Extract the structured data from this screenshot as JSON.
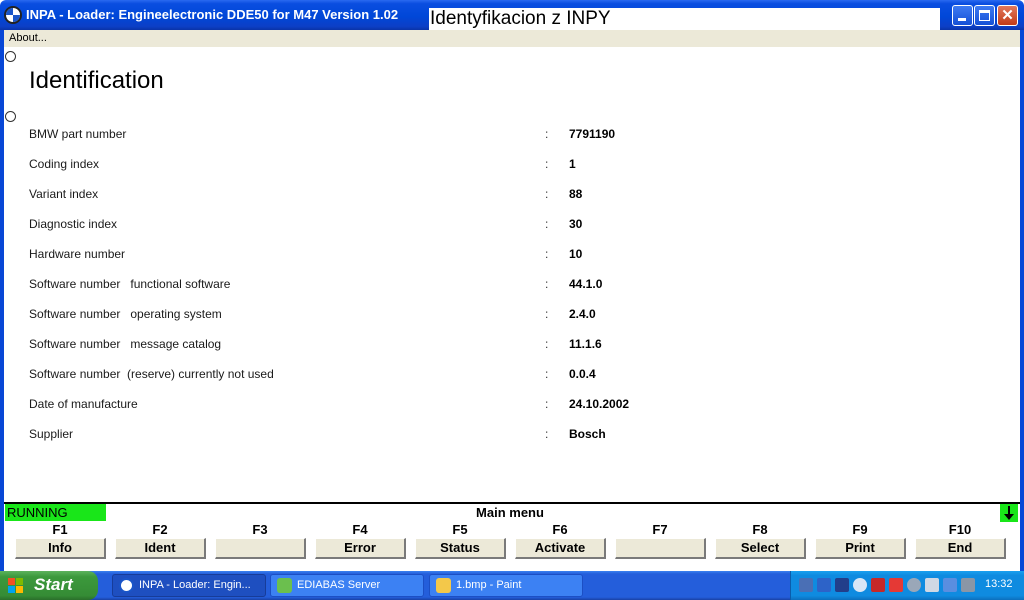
{
  "window": {
    "title": "INPA - Loader:  Engineelectronic DDE50 for M47 Version 1.02",
    "overlay_caption": "Identyfikacion z INPY"
  },
  "menu": {
    "about": "About..."
  },
  "main": {
    "heading": "Identification",
    "rows": [
      {
        "label": "BMW part number",
        "value": "7791190"
      },
      {
        "label": "Coding index",
        "value": "1"
      },
      {
        "label": "Variant index",
        "value": "88"
      },
      {
        "label": "Diagnostic index",
        "value": "30"
      },
      {
        "label": "Hardware number",
        "value": "10"
      },
      {
        "label": "Software number   functional software",
        "value": "44.1.0"
      },
      {
        "label": "Software number   operating system",
        "value": "2.4.0"
      },
      {
        "label": "Software number   message catalog",
        "value": "11.1.6"
      },
      {
        "label": "Software number  (reserve) currently not used",
        "value": "0.0.4"
      },
      {
        "label": "Date of manufacture",
        "value": "24.10.2002"
      },
      {
        "label": "Supplier",
        "value": "Bosch"
      }
    ],
    "separator": ":"
  },
  "status": {
    "state": "RUNNING",
    "menu_title": "Main menu",
    "state_color": "#19e619"
  },
  "fkeys": [
    {
      "key": "F1",
      "label": "Info"
    },
    {
      "key": "F2",
      "label": "Ident"
    },
    {
      "key": "F3",
      "label": ""
    },
    {
      "key": "F4",
      "label": "Error"
    },
    {
      "key": "F5",
      "label": "Status"
    },
    {
      "key": "F6",
      "label": "Activate"
    },
    {
      "key": "F7",
      "label": ""
    },
    {
      "key": "F8",
      "label": "Select"
    },
    {
      "key": "F9",
      "label": "Print"
    },
    {
      "key": "F10",
      "label": "End"
    }
  ],
  "taskbar": {
    "start": "Start",
    "tasks": [
      {
        "label": "INPA - Loader:  Engin...",
        "icon": "bmw-icon"
      },
      {
        "label": "EDIABAS Server",
        "icon": "ediabas-icon"
      },
      {
        "label": "1.bmp - Paint",
        "icon": "paint-icon"
      }
    ],
    "clock": "13:32"
  }
}
